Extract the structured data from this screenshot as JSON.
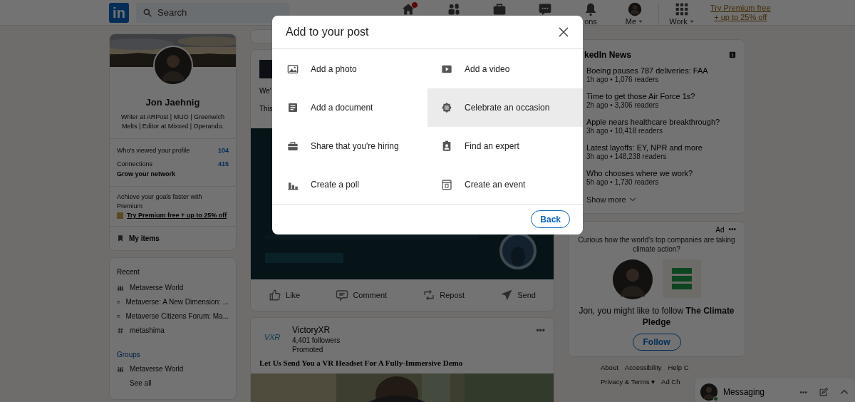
{
  "nav": {
    "logo": "in",
    "search": {
      "placeholder": "Search"
    },
    "items": [
      {
        "kind": "home",
        "badge": true
      },
      {
        "kind": "network",
        "badge": false
      },
      {
        "kind": "jobs",
        "badge": false
      },
      {
        "kind": "messaging",
        "badge": false
      },
      {
        "kind": "notifications",
        "badge": false,
        "label": "ons"
      },
      {
        "kind": "me",
        "badge": false,
        "label": "Me"
      },
      {
        "kind": "work",
        "badge": false,
        "label": "Work"
      }
    ],
    "premium_link": [
      "Try Premium free",
      "+ up to 25% off"
    ]
  },
  "profile": {
    "name": "Jon Jaehnig",
    "headline": "Writer at ARPost | MUO | Greenwich Melts | Editor at Mixxed | Operando.",
    "stats": [
      {
        "label": "Who's viewed your profile",
        "value": "104"
      },
      {
        "label": "Connections",
        "value": "415"
      }
    ],
    "grow": "Grow your network",
    "premium_text": "Achieve your goals faster with Premium",
    "premium_link": "Try Premium free + up to 25% off",
    "my_items": "My items"
  },
  "recent": {
    "heading": "Recent",
    "items": [
      {
        "kind": "group",
        "label": "Metaverse World"
      },
      {
        "kind": "event",
        "label": "Metaverse: A New Dimension: ..."
      },
      {
        "kind": "event",
        "label": "Metaverse Citizens Forum: Ma..."
      },
      {
        "kind": "hashtag",
        "label": "metashima"
      }
    ],
    "groups_heading": "Groups",
    "groups": [
      {
        "kind": "group",
        "label": "Metaverse World"
      }
    ],
    "see_all": "See all"
  },
  "post": {
    "lines": [
      "We'",
      "This"
    ],
    "actions": [
      {
        "kind": "like",
        "label": "Like"
      },
      {
        "kind": "comment",
        "label": "Comment"
      },
      {
        "kind": "repost",
        "label": "Repost"
      },
      {
        "kind": "send",
        "label": "Send"
      }
    ]
  },
  "ad_post": {
    "logo": "VXR",
    "company": "VictoryXR",
    "followers": "4,401 followers",
    "promoted": "Promoted",
    "more": "•••",
    "headline": "Let Us Send You a VR Headset For A Fully-Immersive Demo"
  },
  "news": {
    "title": "kedIn News",
    "items": [
      {
        "title": "Boeing pauses 787 deliveries: FAA",
        "meta": "1h ago • 1,076 readers"
      },
      {
        "title": "Time to get those Air Force 1s?",
        "meta": "2h ago • 3,306 readers"
      },
      {
        "title": "Apple nears healthcare breakthrough?",
        "meta": "3h ago • 10,418 readers"
      },
      {
        "title": "Latest layoffs: EY, NPR and more",
        "meta": "3h ago • 148,238 readers"
      },
      {
        "title": "Who chooses where we work?",
        "meta": "5h ago • 1,730 readers"
      }
    ],
    "show_more": "Show more"
  },
  "ad": {
    "label": "Ad",
    "more": "•••",
    "text": "Curious how the world's top companies are taking climate action?",
    "follow_text": "Jon, you might like to follow **The Climate Pledge**",
    "button": "Follow"
  },
  "footer": {
    "links": [
      "About",
      "Accessibility",
      "Help C",
      "Privacy & Terms ▾",
      "Ad Ch"
    ]
  },
  "messaging": {
    "label": "Messaging",
    "online": true,
    "more": "•••"
  },
  "modal": {
    "title": "Add to your post",
    "options": [
      {
        "label": "Add a photo",
        "selected": false
      },
      {
        "kind": "video",
        "label": "Add a video",
        "selected": false
      },
      {
        "kind": "document",
        "label": "Add a document",
        "selected": false
      },
      {
        "kind": "occasion",
        "label": "Celebrate an occasion",
        "selected": true
      },
      {
        "kind": "hiring",
        "label": "Share that you're hiring",
        "selected": false
      },
      {
        "kind": "expert",
        "label": "Find an expert",
        "selected": false
      },
      {
        "kind": "poll",
        "label": "Create a poll",
        "selected": false
      },
      {
        "kind": "event",
        "label": "Create an event",
        "selected": false
      }
    ],
    "back": "Back"
  }
}
